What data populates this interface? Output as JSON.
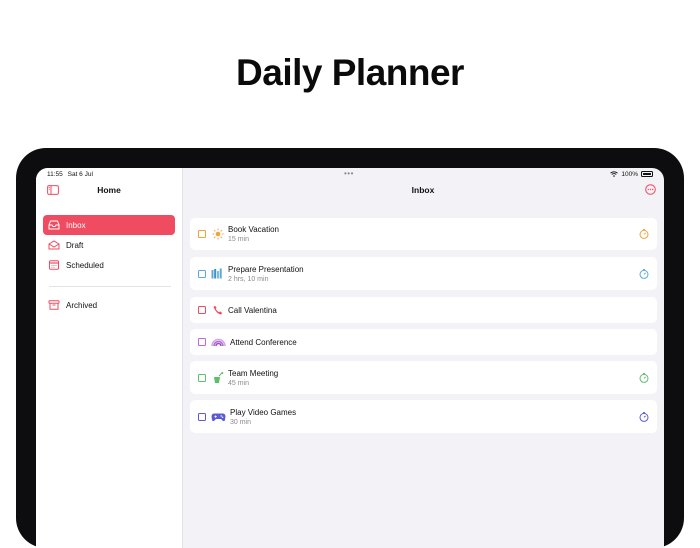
{
  "hero": {
    "title": "Daily Planner"
  },
  "status_bar": {
    "time": "11:55",
    "date": "Sat 6 Jul",
    "battery": "100%"
  },
  "sidebar": {
    "title": "Home",
    "items": [
      {
        "label": "Inbox",
        "icon": "inbox-icon",
        "active": true
      },
      {
        "label": "Draft",
        "icon": "draft-icon",
        "active": false
      },
      {
        "label": "Scheduled",
        "icon": "calendar-icon",
        "active": false
      },
      {
        "label": "Archived",
        "icon": "archive-icon",
        "active": false
      }
    ]
  },
  "main": {
    "title": "Inbox",
    "tasks": [
      {
        "title": "Book Vacation",
        "subtitle": "15 min",
        "color": "#f0a33a",
        "icon": "sun-icon",
        "has_timer": true
      },
      {
        "title": "Prepare Presentation",
        "subtitle": "2 hrs, 10 min",
        "color": "#5ea8d8",
        "icon": "books-icon",
        "has_timer": true
      },
      {
        "title": "Call Valentina",
        "subtitle": "",
        "color": "#ef4c61",
        "icon": "phone-icon",
        "has_timer": false
      },
      {
        "title": "Attend Conference",
        "subtitle": "",
        "color": "#b86bd6",
        "icon": "rainbow-icon",
        "has_timer": false
      },
      {
        "title": "Team Meeting",
        "subtitle": "45 min",
        "color": "#5cbf6a",
        "icon": "podium-icon",
        "has_timer": true
      },
      {
        "title": "Play Video Games",
        "subtitle": "30 min",
        "color": "#5b5bd6",
        "icon": "gamepad-icon",
        "has_timer": true
      }
    ]
  },
  "colors": {
    "accent": "#ef4c61",
    "background": "#f2f2f7"
  }
}
